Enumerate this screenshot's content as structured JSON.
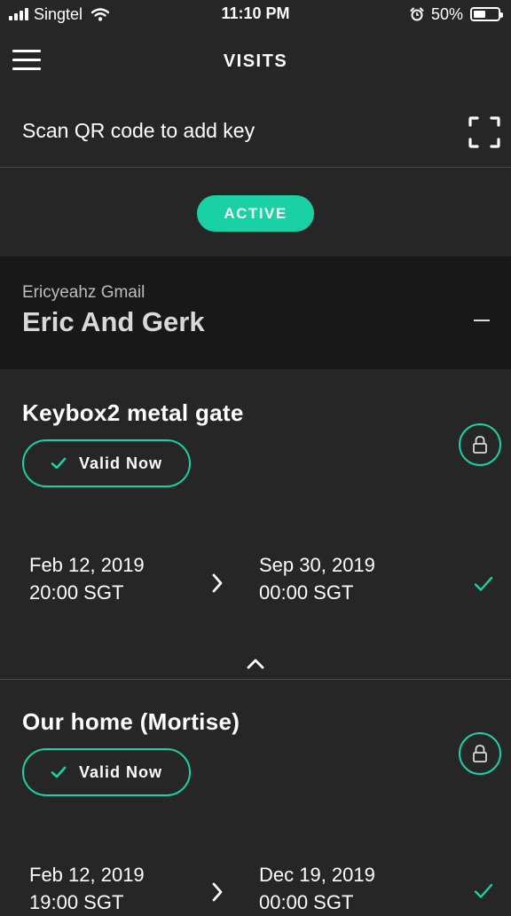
{
  "status_bar": {
    "carrier": "Singtel",
    "time": "11:10 PM",
    "battery": "50%",
    "battery_level": 0.5
  },
  "header": {
    "title": "VISITS"
  },
  "scan": {
    "label": "Scan QR code to add key"
  },
  "filter": {
    "active_label": "ACTIVE"
  },
  "group": {
    "subtitle": "Ericyeahz Gmail",
    "title": "Eric And Gerk"
  },
  "keys": [
    {
      "name": "Keybox2 metal gate",
      "status": "Valid Now",
      "start_date": "Feb 12, 2019",
      "start_time": "20:00 SGT",
      "end_date": "Sep 30, 2019",
      "end_time": "00:00 SGT"
    },
    {
      "name": "Our home (Mortise)",
      "status": "Valid Now",
      "start_date": "Feb 12, 2019",
      "start_time": "19:00 SGT",
      "end_date": "Dec 19, 2019",
      "end_time": "00:00 SGT"
    }
  ],
  "colors": {
    "accent": "#1ad1a5",
    "background": "#262626",
    "group_header": "#181818"
  },
  "icons": [
    "menu-icon",
    "scan-qr-icon",
    "collapse-icon",
    "check-icon",
    "lock-icon",
    "chevron-right-icon",
    "chevron-up-icon"
  ]
}
